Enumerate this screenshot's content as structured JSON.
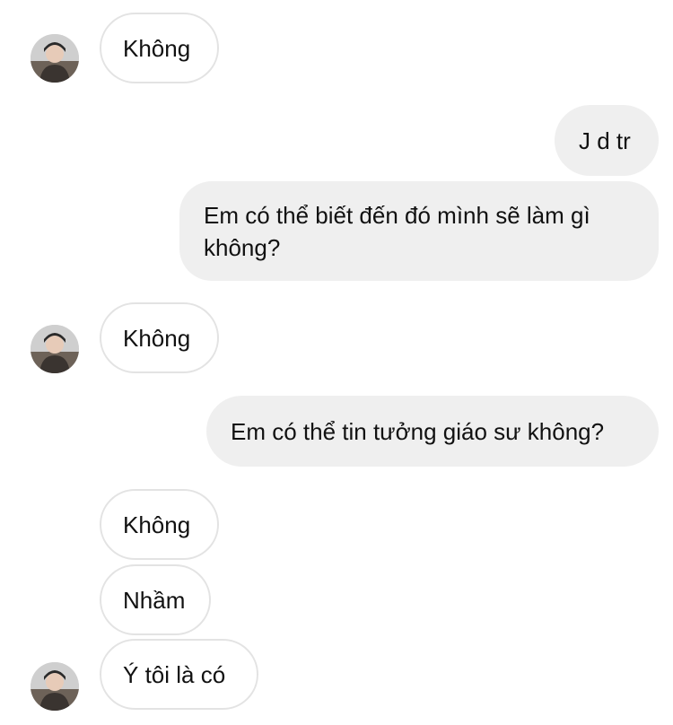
{
  "messages": [
    {
      "from": "them",
      "text": "Không",
      "avatar": true
    },
    {
      "from": "me",
      "text": "J d tr"
    },
    {
      "from": "me",
      "text": "Em có thể biết đến đó mình sẽ làm gì\nkhông?"
    },
    {
      "from": "them",
      "text": "Không",
      "avatar": true
    },
    {
      "from": "me",
      "text": "Em có thể tin tưởng giáo sư không?"
    },
    {
      "from": "them",
      "text": "Không",
      "avatar": false
    },
    {
      "from": "them",
      "text": "Nhầm",
      "avatar": false
    },
    {
      "from": "them",
      "text": "Ý tôi là có",
      "avatar": true
    }
  ],
  "colors": {
    "received_bubble_border": "#e3e3e3",
    "sent_bubble_bg": "#efefef",
    "text": "#111111"
  },
  "icons": {
    "avatar": "user-photo-avatar"
  }
}
